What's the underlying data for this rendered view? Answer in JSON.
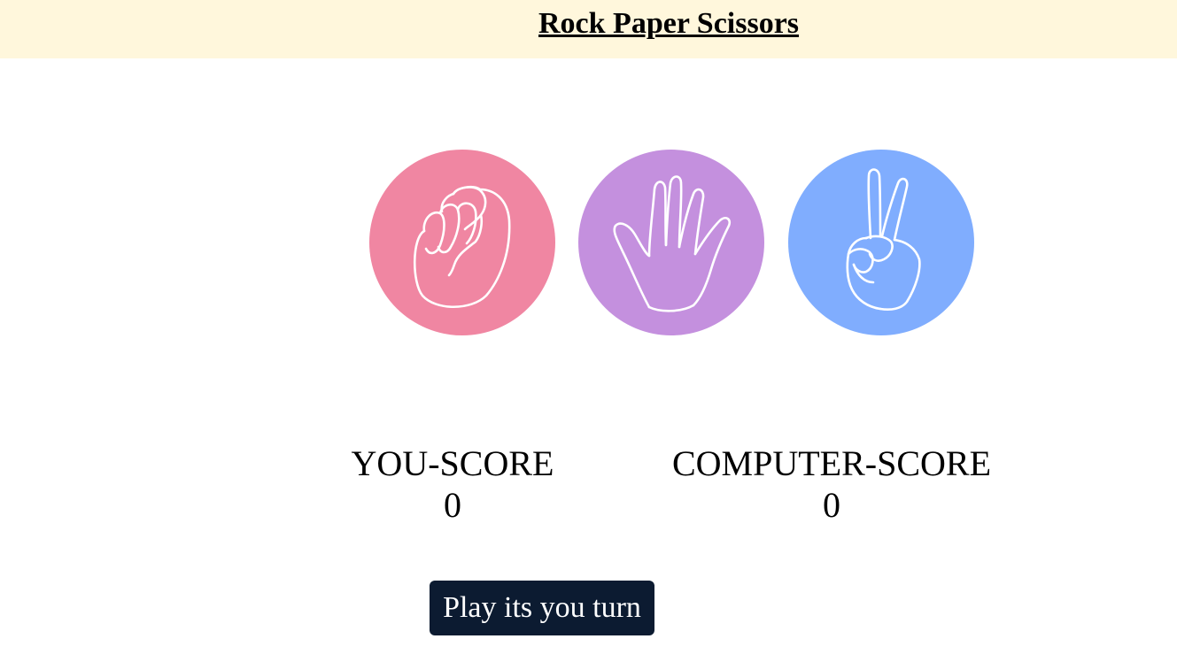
{
  "header": {
    "title": "Rock Paper Scissors",
    "background_color": "#fff7dc"
  },
  "choices": [
    {
      "id": "rock",
      "icon": "fist-icon",
      "color": "#f086a2"
    },
    {
      "id": "paper",
      "icon": "open-hand-icon",
      "color": "#c490de"
    },
    {
      "id": "scissors",
      "icon": "peace-sign-hand-icon",
      "color": "#80adfe"
    }
  ],
  "scores": {
    "you": {
      "label": "YOU-SCORE",
      "value": "0"
    },
    "computer": {
      "label": "COMPUTER-SCORE",
      "value": "0"
    }
  },
  "play_button": {
    "label": "Play its you turn",
    "color": "#0c1b31"
  }
}
